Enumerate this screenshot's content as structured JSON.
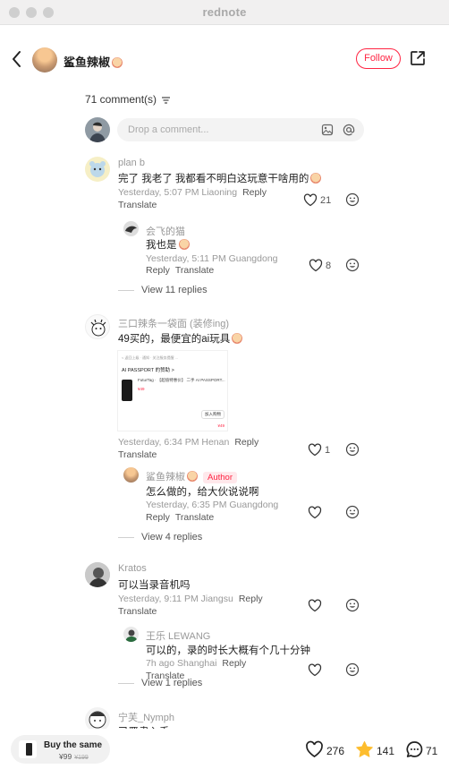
{
  "window": {
    "title": "rednote"
  },
  "header": {
    "author_name": "鲨鱼辣椒",
    "follow_label": "Follow"
  },
  "comments_count": "71 comment(s)",
  "input": {
    "placeholder": "Drop a comment..."
  },
  "actions": {
    "reply": "Reply",
    "translate": "Translate",
    "author": "Author"
  },
  "comments": [
    {
      "name": "plan b",
      "text": "完了 我老了 我都看不明白这玩意干啥用的",
      "meta": "Yesterday, 5:07 PM Liaoning",
      "likes": "21",
      "replies": [
        {
          "name": "会飞的猫",
          "text": "我也是",
          "meta": "Yesterday, 5:11 PM Guangdong",
          "likes": "8"
        }
      ],
      "view_more": "View 11 replies"
    },
    {
      "name": "三口辣条一袋面 (装修ing)",
      "text": "49买的，最便宜的ai玩具",
      "meta": "Yesterday, 6:34 PM Henan",
      "likes": "1",
      "attachment": {
        "line1": "< 返回上级 ·  通知 · 关注服务提醒 ...",
        "heading": "AI PASSPORT 的赞助 >",
        "product": "FuturTag · 【超值特惠价】 二手 AI PASSPORT...",
        "price": "¥49",
        "button": "加入购物",
        "footer": "¥49"
      },
      "replies": [
        {
          "name": "鲨鱼辣椒",
          "text": "怎么做的，给大伙说说啊",
          "meta": "Yesterday, 6:35 PM Guangdong",
          "likes": ""
        }
      ],
      "view_more": "View 4 replies"
    },
    {
      "name": "Kratos",
      "text": "可以当录音机吗",
      "meta": "Yesterday, 9:11 PM Jiangsu",
      "likes": "",
      "replies": [
        {
          "name": "王乐 LEWANG",
          "text": "可以的，录的时长大概有个几十分钟",
          "meta": "7h ago Shanghai",
          "likes": ""
        }
      ],
      "view_more": "View 1 replies"
    },
    {
      "name": "宁芙_Nymph",
      "text": "已严肃入手"
    }
  ],
  "bottom": {
    "buy_label": "Buy the same",
    "price": "¥99",
    "old_price": "¥199",
    "likes": "276",
    "stars": "141",
    "comments": "71"
  }
}
